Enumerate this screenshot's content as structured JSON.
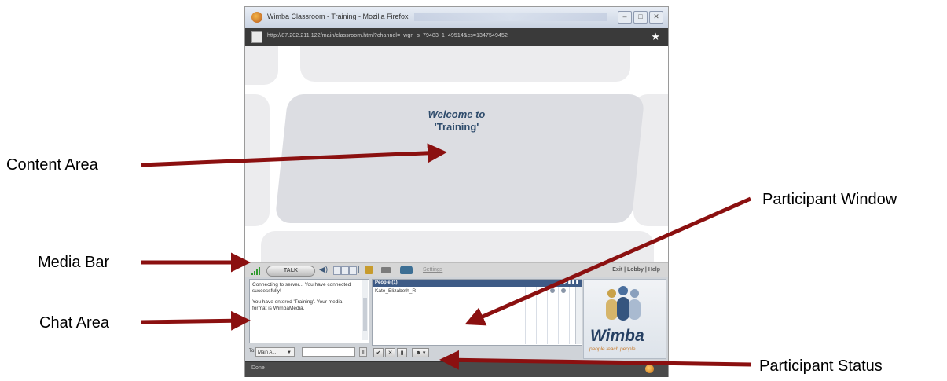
{
  "window": {
    "title": "Wimba Classroom - Training - Mozilla Firefox",
    "url": "http://87.202.211.122/main/classroom.html?channel=_wgn_s_79483_1_49514&cs=1347549452",
    "status": "Done"
  },
  "window_buttons": [
    "–",
    "□",
    "✕"
  ],
  "slide": {
    "line1": "Welcome to",
    "line2": "'Training'"
  },
  "media_bar": {
    "talk_label": "TALK",
    "settings_label": "Settings",
    "links": "Exit | Lobby | Help"
  },
  "chat": {
    "messages": [
      "Connecting to server... You have connected successfully!",
      "You have entered 'Training'. Your media format is WimbaMedia."
    ],
    "to_label": "To:",
    "to_value": "Main A...",
    "send_label": "II"
  },
  "people": {
    "header": "People (1)",
    "participant": "Kate_Elizabeth_R"
  },
  "status_buttons": [
    "✔",
    "✕",
    "▮",
    "☻ ▾"
  ],
  "logo": {
    "name": "Wimba",
    "tagline": "people teach people"
  },
  "annotations": {
    "content_area": "Content Area",
    "media_bar": "Media Bar",
    "chat_area": "Chat Area",
    "participant_window": "Participant Window",
    "participant_status": "Participant Status"
  },
  "colors": {
    "arrow": "#8b1010",
    "header_blue": "#3e5b86",
    "wimba_blue": "#253f62",
    "wimba_orange": "#c77a2a"
  },
  "icons": {
    "signal": "signal-strength-icon",
    "speaker": "speaker-icon",
    "lock": "lock-icon",
    "camera": "camera-icon",
    "phone": "phone-icon",
    "star": "bookmark-star-icon",
    "firefox": "firefox-icon"
  }
}
